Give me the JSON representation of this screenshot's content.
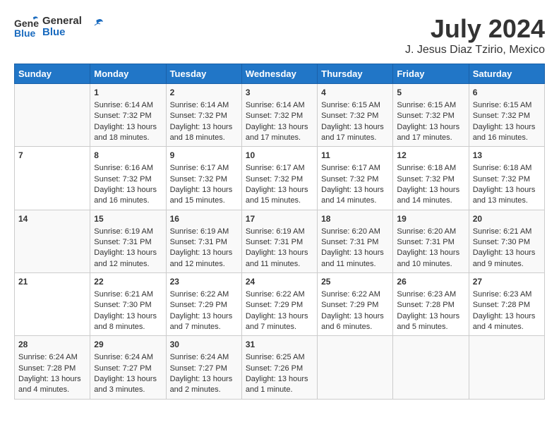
{
  "header": {
    "logo_line1": "General",
    "logo_line2": "Blue",
    "month_year": "July 2024",
    "location": "J. Jesus Diaz Tzirio, Mexico"
  },
  "weekdays": [
    "Sunday",
    "Monday",
    "Tuesday",
    "Wednesday",
    "Thursday",
    "Friday",
    "Saturday"
  ],
  "weeks": [
    [
      {
        "day": "",
        "info": ""
      },
      {
        "day": "1",
        "info": "Sunrise: 6:14 AM\nSunset: 7:32 PM\nDaylight: 13 hours\nand 18 minutes."
      },
      {
        "day": "2",
        "info": "Sunrise: 6:14 AM\nSunset: 7:32 PM\nDaylight: 13 hours\nand 18 minutes."
      },
      {
        "day": "3",
        "info": "Sunrise: 6:14 AM\nSunset: 7:32 PM\nDaylight: 13 hours\nand 17 minutes."
      },
      {
        "day": "4",
        "info": "Sunrise: 6:15 AM\nSunset: 7:32 PM\nDaylight: 13 hours\nand 17 minutes."
      },
      {
        "day": "5",
        "info": "Sunrise: 6:15 AM\nSunset: 7:32 PM\nDaylight: 13 hours\nand 17 minutes."
      },
      {
        "day": "6",
        "info": "Sunrise: 6:15 AM\nSunset: 7:32 PM\nDaylight: 13 hours\nand 16 minutes."
      }
    ],
    [
      {
        "day": "7",
        "info": ""
      },
      {
        "day": "8",
        "info": "Sunrise: 6:16 AM\nSunset: 7:32 PM\nDaylight: 13 hours\nand 16 minutes."
      },
      {
        "day": "9",
        "info": "Sunrise: 6:17 AM\nSunset: 7:32 PM\nDaylight: 13 hours\nand 15 minutes."
      },
      {
        "day": "10",
        "info": "Sunrise: 6:17 AM\nSunset: 7:32 PM\nDaylight: 13 hours\nand 15 minutes."
      },
      {
        "day": "11",
        "info": "Sunrise: 6:17 AM\nSunset: 7:32 PM\nDaylight: 13 hours\nand 14 minutes."
      },
      {
        "day": "12",
        "info": "Sunrise: 6:18 AM\nSunset: 7:32 PM\nDaylight: 13 hours\nand 14 minutes."
      },
      {
        "day": "13",
        "info": "Sunrise: 6:18 AM\nSunset: 7:32 PM\nDaylight: 13 hours\nand 13 minutes."
      }
    ],
    [
      {
        "day": "14",
        "info": ""
      },
      {
        "day": "15",
        "info": "Sunrise: 6:19 AM\nSunset: 7:31 PM\nDaylight: 13 hours\nand 12 minutes."
      },
      {
        "day": "16",
        "info": "Sunrise: 6:19 AM\nSunset: 7:31 PM\nDaylight: 13 hours\nand 12 minutes."
      },
      {
        "day": "17",
        "info": "Sunrise: 6:19 AM\nSunset: 7:31 PM\nDaylight: 13 hours\nand 11 minutes."
      },
      {
        "day": "18",
        "info": "Sunrise: 6:20 AM\nSunset: 7:31 PM\nDaylight: 13 hours\nand 11 minutes."
      },
      {
        "day": "19",
        "info": "Sunrise: 6:20 AM\nSunset: 7:31 PM\nDaylight: 13 hours\nand 10 minutes."
      },
      {
        "day": "20",
        "info": "Sunrise: 6:21 AM\nSunset: 7:30 PM\nDaylight: 13 hours\nand 9 minutes."
      }
    ],
    [
      {
        "day": "21",
        "info": ""
      },
      {
        "day": "22",
        "info": "Sunrise: 6:21 AM\nSunset: 7:30 PM\nDaylight: 13 hours\nand 8 minutes."
      },
      {
        "day": "23",
        "info": "Sunrise: 6:22 AM\nSunset: 7:29 PM\nDaylight: 13 hours\nand 7 minutes."
      },
      {
        "day": "24",
        "info": "Sunrise: 6:22 AM\nSunset: 7:29 PM\nDaylight: 13 hours\nand 7 minutes."
      },
      {
        "day": "25",
        "info": "Sunrise: 6:22 AM\nSunset: 7:29 PM\nDaylight: 13 hours\nand 6 minutes."
      },
      {
        "day": "26",
        "info": "Sunrise: 6:23 AM\nSunset: 7:28 PM\nDaylight: 13 hours\nand 5 minutes."
      },
      {
        "day": "27",
        "info": "Sunrise: 6:23 AM\nSunset: 7:28 PM\nDaylight: 13 hours\nand 4 minutes."
      }
    ],
    [
      {
        "day": "28",
        "info": "Sunrise: 6:24 AM\nSunset: 7:28 PM\nDaylight: 13 hours\nand 4 minutes."
      },
      {
        "day": "29",
        "info": "Sunrise: 6:24 AM\nSunset: 7:27 PM\nDaylight: 13 hours\nand 3 minutes."
      },
      {
        "day": "30",
        "info": "Sunrise: 6:24 AM\nSunset: 7:27 PM\nDaylight: 13 hours\nand 2 minutes."
      },
      {
        "day": "31",
        "info": "Sunrise: 6:25 AM\nSunset: 7:26 PM\nDaylight: 13 hours\nand 1 minute."
      },
      {
        "day": "",
        "info": ""
      },
      {
        "day": "",
        "info": ""
      },
      {
        "day": "",
        "info": ""
      }
    ]
  ]
}
